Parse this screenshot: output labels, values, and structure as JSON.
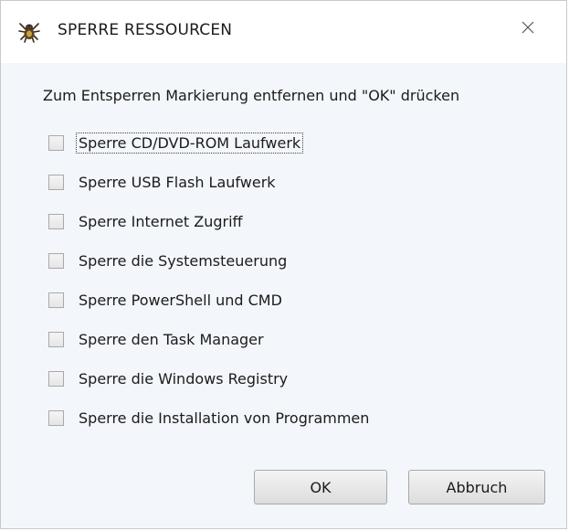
{
  "window": {
    "title": "SPERRE RESSOURCEN",
    "app_icon": "spider-icon",
    "close_icon": "close-icon"
  },
  "dialog": {
    "instruction": "Zum Entsperren Markierung entfernen und \"OK\" drücken",
    "options": [
      {
        "label": "Sperre CD/DVD-ROM Laufwerk",
        "checked": false,
        "focused": true
      },
      {
        "label": "Sperre USB Flash Laufwerk",
        "checked": false
      },
      {
        "label": "Sperre Internet Zugriff",
        "checked": false
      },
      {
        "label": "Sperre die Systemsteuerung",
        "checked": false
      },
      {
        "label": "Sperre PowerShell und CMD",
        "checked": false
      },
      {
        "label": "Sperre den Task Manager",
        "checked": false
      },
      {
        "label": "Sperre die Windows Registry",
        "checked": false
      },
      {
        "label": "Sperre die Installation von Programmen",
        "checked": false
      }
    ],
    "ok_label": "OK",
    "cancel_label": "Abbruch"
  }
}
